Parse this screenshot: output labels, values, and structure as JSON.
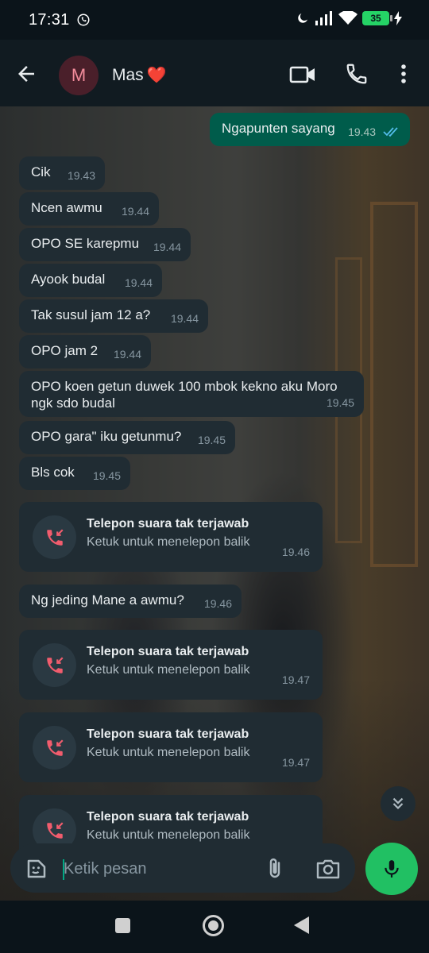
{
  "status_bar": {
    "time": "17:31",
    "battery": "35"
  },
  "header": {
    "avatar_letter": "M",
    "contact_name": "Mas",
    "name_emoji": "❤️"
  },
  "messages": {
    "out_1": {
      "text": "Ngapunten sayang",
      "time": "19.43",
      "status": "read"
    },
    "in_1": {
      "text": "Cik",
      "time": "19.43"
    },
    "in_2": {
      "text": "Ncen awmu",
      "time": "19.44"
    },
    "in_3": {
      "text": "OPO SE karepmu",
      "time": "19.44"
    },
    "in_4": {
      "text": "Ayook budal",
      "time": "19.44"
    },
    "in_5": {
      "text": "Tak susul jam 12 a?",
      "time": "19.44"
    },
    "in_6": {
      "text": "OPO jam 2",
      "time": "19.44"
    },
    "in_7": {
      "text": "OPO koen getun duwek 100 mbok kekno aku Moro ngk sdo budal",
      "time": "19.45"
    },
    "in_8": {
      "text": "OPO gara\" iku getunmu?",
      "time": "19.45"
    },
    "in_9": {
      "text": "Bls cok",
      "time": "19.45"
    },
    "call_1": {
      "title": "Telepon suara tak terjawab",
      "subtitle": "Ketuk untuk menelepon balik",
      "time": "19.46"
    },
    "in_10": {
      "text": "Ng jeding Mane a awmu?",
      "time": "19.46"
    },
    "call_2": {
      "title": "Telepon suara tak terjawab",
      "subtitle": "Ketuk untuk menelepon balik",
      "time": "19.47"
    },
    "call_3": {
      "title": "Telepon suara tak terjawab",
      "subtitle": "Ketuk untuk menelepon balik",
      "time": "19.47"
    },
    "call_4": {
      "title": "Telepon suara tak terjawab",
      "subtitle": "Ketuk untuk menelepon balik"
    }
  },
  "composer": {
    "placeholder": "Ketik pesan"
  },
  "colors": {
    "accent": "#21c063",
    "missed_call": "#f15c6d",
    "outgoing_bubble": "#005c4b",
    "incoming_bubble": "#202c33"
  }
}
